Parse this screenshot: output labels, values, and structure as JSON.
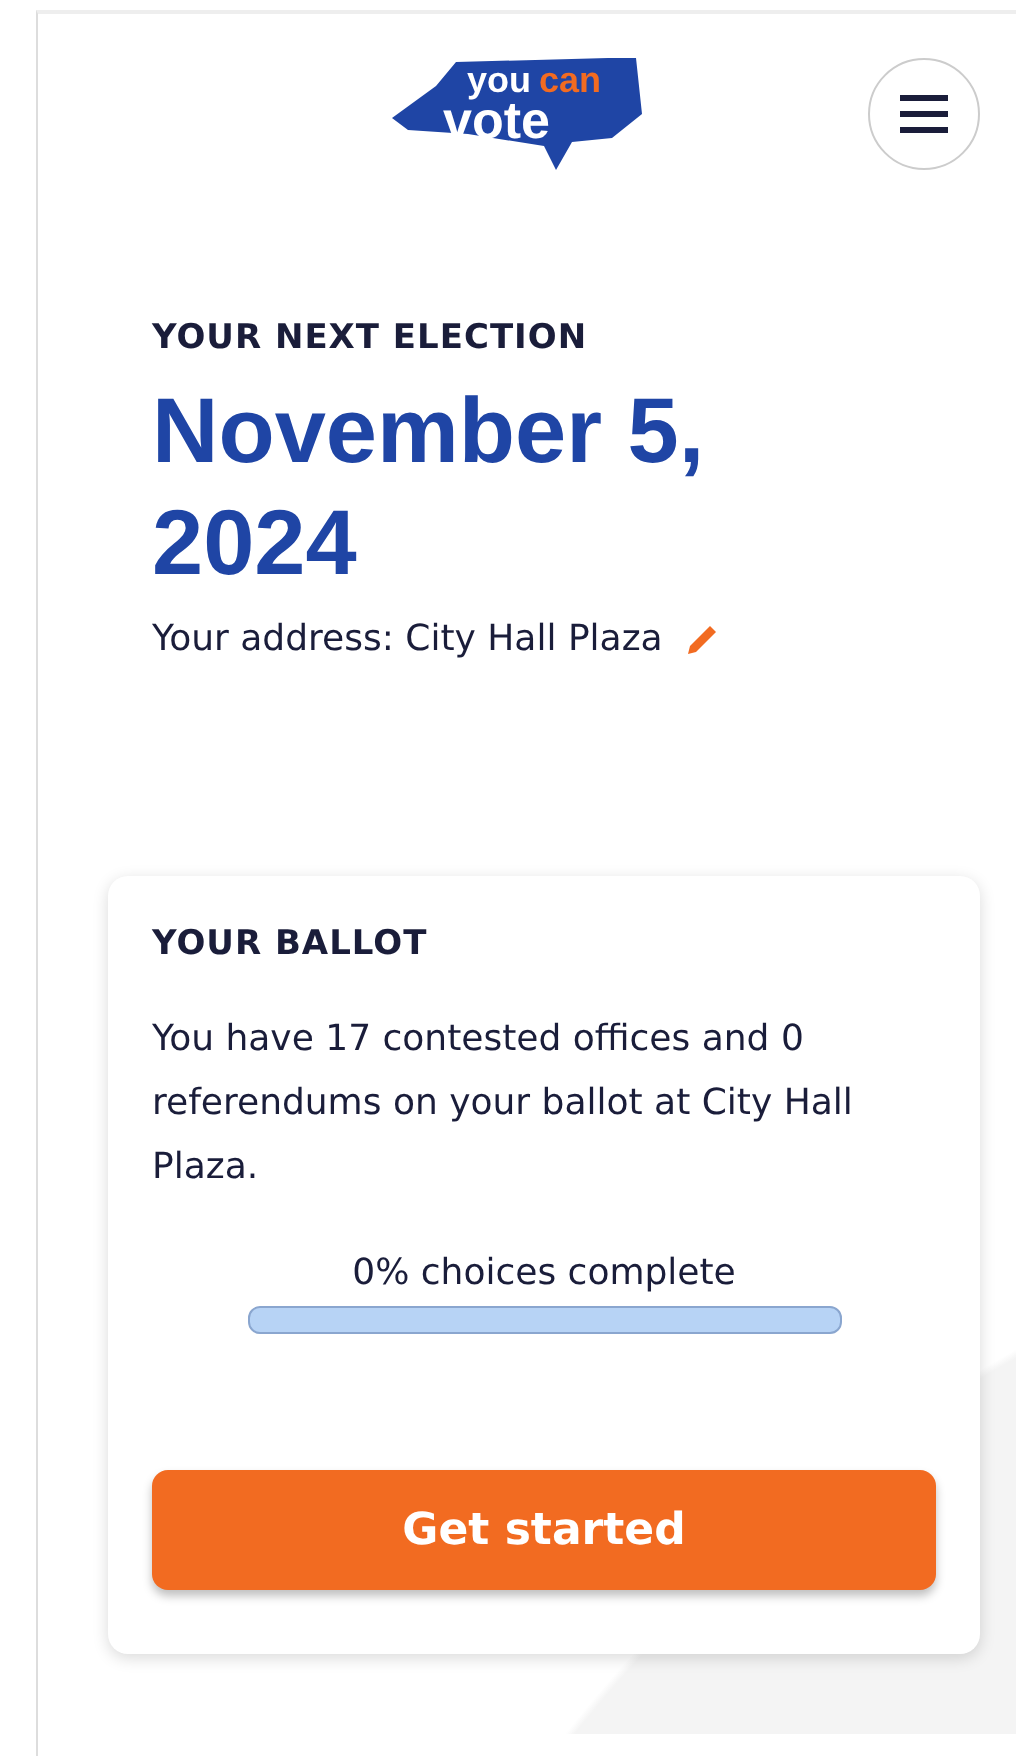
{
  "logo": {
    "word_top": "you",
    "word_accent": "can",
    "word_bottom": "vote"
  },
  "election": {
    "eyebrow": "YOUR NEXT ELECTION",
    "date": "November 5, 2024",
    "address": "Your address: City Hall Plaza"
  },
  "ballot": {
    "title": "YOUR BALLOT",
    "description": "You have 17 contested offices and 0 referendums on your ballot at City Hall Plaza.",
    "progress_label": "0% choices complete",
    "level": 0,
    "button": "Get started"
  }
}
